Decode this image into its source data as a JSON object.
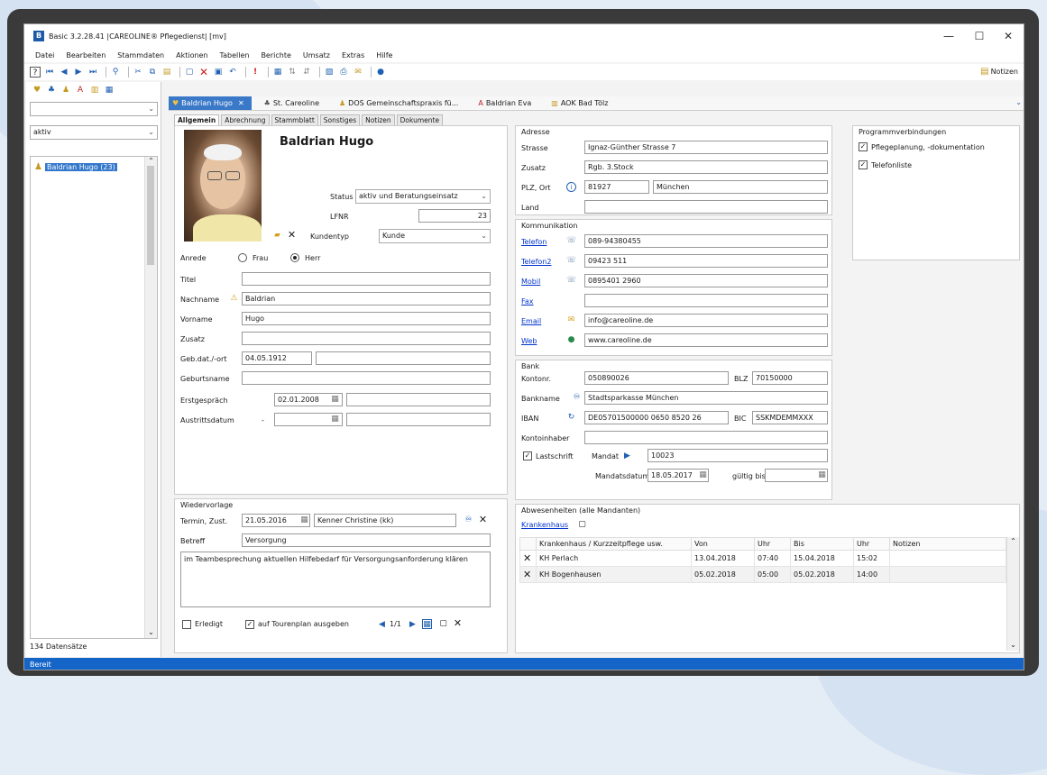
{
  "window": {
    "title": "Basic 3.2.28.41 |CAREOLINE® Pflegedienst| [mv]",
    "app_icon": "B",
    "min": "—",
    "max": "☐",
    "close": "✕"
  },
  "menu": [
    "Datei",
    "Bearbeiten",
    "Stammdaten",
    "Aktionen",
    "Tabellen",
    "Berichte",
    "Umsatz",
    "Extras",
    "Hilfe"
  ],
  "notes_button": "Notizen",
  "left": {
    "filter_value": "aktiv",
    "item": "Baldrian Hugo (23)",
    "record_count": "134 Datensätze"
  },
  "doc_tabs": [
    "Baldrian Hugo",
    "St. Careoline",
    "DOS Gemeinschaftspraxis fü...",
    "Baldrian Eva",
    "AOK Bad Tölz"
  ],
  "sub_tabs": [
    "Allgemein",
    "Abrechnung",
    "Stammblatt",
    "Sonstiges",
    "Notizen",
    "Dokumente"
  ],
  "person": {
    "name": "Baldrian Hugo",
    "status_label": "Status",
    "status_value": "aktiv und Beratungseinsatz",
    "lfnr_label": "LFNR",
    "lfnr_value": "23",
    "kundentyp_label": "Kundentyp",
    "kundentyp_value": "Kunde",
    "anrede_label": "Anrede",
    "frau": "Frau",
    "herr": "Herr",
    "titel_label": "Titel",
    "titel_value": "",
    "nachname_label": "Nachname",
    "nachname_value": "Baldrian",
    "vorname_label": "Vorname",
    "vorname_value": "Hugo",
    "zusatz_label": "Zusatz",
    "zusatz_value": "",
    "geb_label": "Geb.dat./-ort",
    "geb_value": "04.05.1912",
    "geb_ort": "",
    "geburtsname_label": "Geburtsname",
    "geburtsname_value": "",
    "erstgespraech_label": "Erstgespräch",
    "erstgespraech_value": "02.01.2008",
    "austritt_label": "Austrittsdatum",
    "austritt_value": "-"
  },
  "adresse": {
    "title": "Adresse",
    "strasse_label": "Strasse",
    "strasse": "Ignaz-Günther Strasse 7",
    "zusatz_label": "Zusatz",
    "zusatz": "Rgb. 3.Stock",
    "plz_label": "PLZ, Ort",
    "plz": "81927",
    "ort": "München",
    "land_label": "Land",
    "land": ""
  },
  "programm": {
    "title": "Programmverbindungen",
    "item1": "Pflegeplanung, -dokumentation",
    "item2": "Telefonliste"
  },
  "kommunikation": {
    "title": "Kommunikation",
    "rows": [
      {
        "label": "Telefon",
        "value": "089-94380455"
      },
      {
        "label": "Telefon2",
        "value": "09423 511"
      },
      {
        "label": "Mobil",
        "value": "0895401 2960"
      },
      {
        "label": "Fax",
        "value": ""
      },
      {
        "label": "Email",
        "value": "info@careoline.de"
      },
      {
        "label": "Web",
        "value": "www.careoline.de"
      }
    ]
  },
  "bank": {
    "title": "Bank",
    "konto_label": "Kontonr.",
    "konto": "050890026",
    "blz_label": "BLZ",
    "blz": "70150000",
    "bankname_label": "Bankname",
    "bankname": "Stadtsparkasse München",
    "iban_label": "IBAN",
    "iban": "DE05701500000 0650 8520 26",
    "bic_label": "BIC",
    "bic": "SSKMDEMMXXX",
    "inhaber_label": "Kontoinhaber",
    "inhaber": "",
    "lastschrift": "Lastschrift",
    "mandat_label": "Mandat",
    "mandat": "10023",
    "mandatsdatum_label": "Mandatsdatum",
    "mandatsdatum": "18.05.2017",
    "gueltig_label": "gültig bis",
    "gueltig": ""
  },
  "wiedervorlage": {
    "title": "Wiedervorlage",
    "termin_label": "Termin, Zust.",
    "termin": "21.05.2016",
    "zust": "Kenner Christine (kk)",
    "betreff_label": "Betreff",
    "betreff": "Versorgung",
    "text": "im Teambesprechung aktuellen Hilfebedarf für Versorgungsanforderung klären",
    "erledigt": "Erledigt",
    "tourenplan": "auf Tourenplan ausgeben",
    "pager": "1/1"
  },
  "abwesenheiten": {
    "title": "Abwesenheiten (alle Mandanten)",
    "link": "Krankenhaus",
    "headers": [
      "Krankenhaus / Kurzzeitpflege usw.",
      "Von",
      "Uhr",
      "Bis",
      "Uhr",
      "Notizen"
    ],
    "rows": [
      [
        "KH Perlach",
        "13.04.2018",
        "07:40",
        "15.04.2018",
        "15:02",
        ""
      ],
      [
        "KH Bogenhausen",
        "05.02.2018",
        "05:00",
        "05.02.2018",
        "14:00",
        ""
      ]
    ]
  },
  "status": "Bereit"
}
